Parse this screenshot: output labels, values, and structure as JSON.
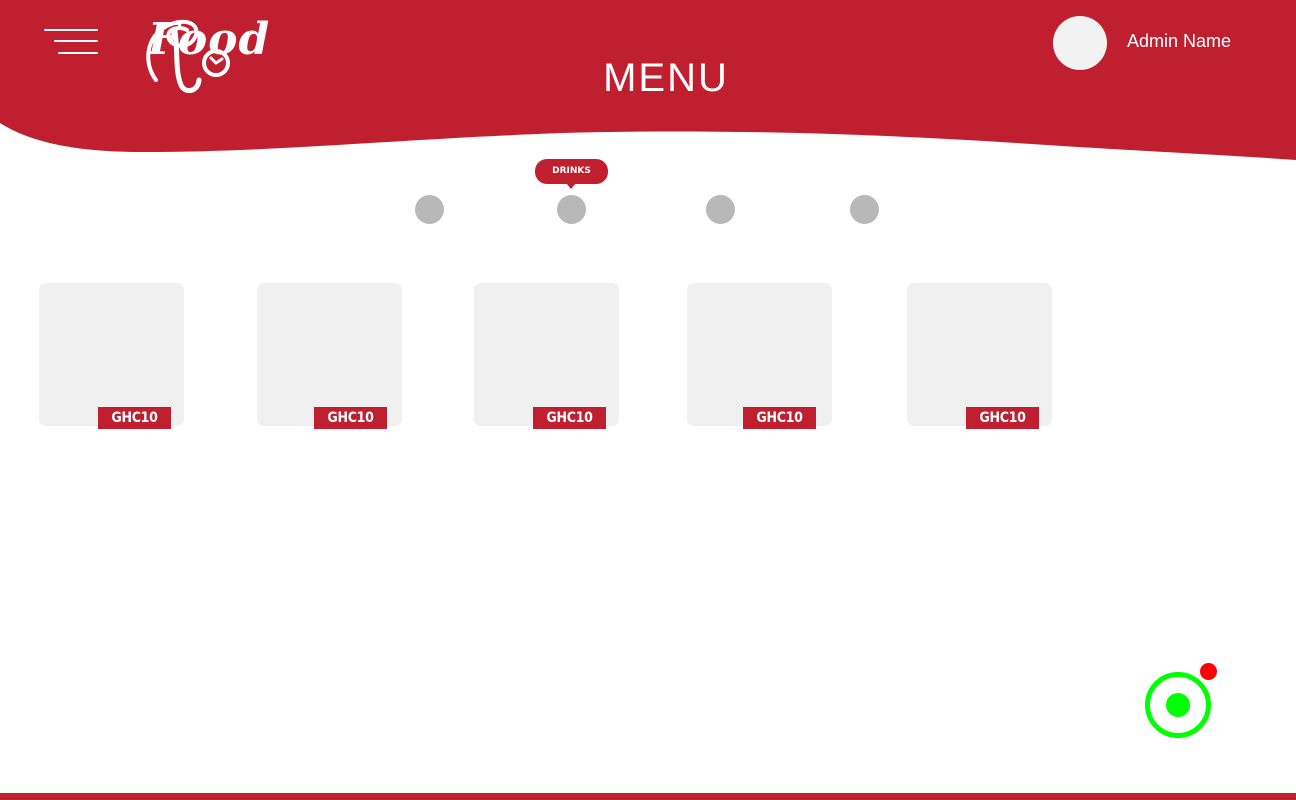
{
  "header": {
    "brand_name": "Food",
    "title": "MENU",
    "admin_name": "Admin Name"
  },
  "categories": {
    "active_tooltip": "DRINKS"
  },
  "products": [
    {
      "price": "GHC10"
    },
    {
      "price": "GHC10"
    },
    {
      "price": "GHC10"
    },
    {
      "price": "GHC10"
    },
    {
      "price": "GHC10"
    }
  ],
  "theme": {
    "brand_red": "#c01f2f",
    "status_green": "#00ff00",
    "badge_red": "#ff0000",
    "card_gray": "#f0f0f0",
    "dot_gray": "#b8b8b8"
  },
  "icons": {
    "menu": "hamburger-menu-icon",
    "logo": "food-logo-icon",
    "avatar": "avatar-icon",
    "fab": "radio-button-icon",
    "notification": "notification-dot-icon"
  }
}
